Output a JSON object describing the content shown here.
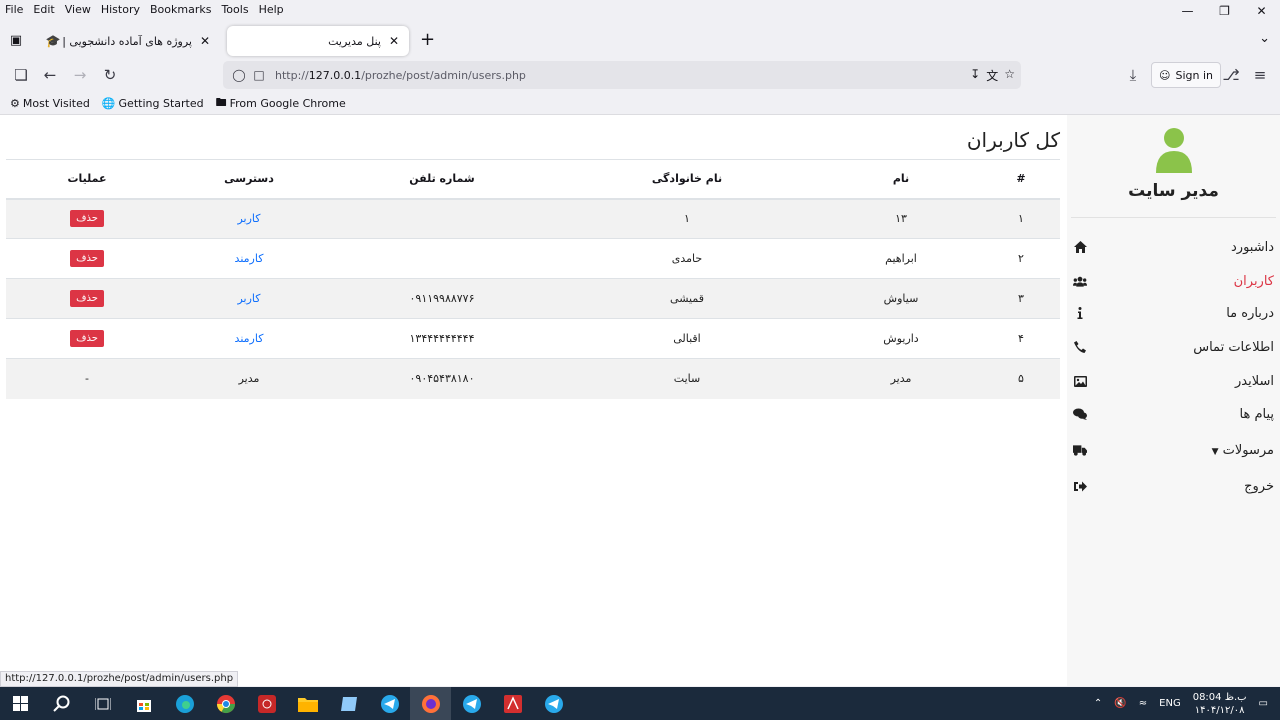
{
  "menubar": [
    "File",
    "Edit",
    "View",
    "History",
    "Bookmarks",
    "Tools",
    "Help"
  ],
  "tabs": [
    {
      "title": "پروژه های آماده دانشجویی | دانلود",
      "active": false
    },
    {
      "title": "پنل مدیریت",
      "active": true
    }
  ],
  "url": {
    "prefix": "http://",
    "host": "127.0.0.1",
    "path": "/prozhe/post/admin/users.php"
  },
  "signin": "Sign in",
  "bookmarks": [
    "Most Visited",
    "Getting Started",
    "From Google Chrome"
  ],
  "page": {
    "title": "کل کاربران",
    "table": {
      "headers": [
        "#",
        "نام",
        "نام خانوادگی",
        "شماره تلفن",
        "دسترسی",
        "عملیات"
      ],
      "rows": [
        {
          "num": "۱",
          "name": "۱۳",
          "last": "۱",
          "phone": "",
          "access": "کاربر",
          "access_link": true,
          "op": "حذف"
        },
        {
          "num": "۲",
          "name": "ابراهیم",
          "last": "حامدی",
          "phone": "",
          "access": "کارمند",
          "access_link": true,
          "op": "حذف"
        },
        {
          "num": "۳",
          "name": "سیاوش",
          "last": "قمیشی",
          "phone": "۰۹۱۱۹۹۸۸۷۷۶",
          "access": "کاربر",
          "access_link": true,
          "op": "حذف"
        },
        {
          "num": "۴",
          "name": "داریوش",
          "last": "اقبالی",
          "phone": "۱۳۴۴۴۴۴۴۴۴۴",
          "access": "کارمند",
          "access_link": true,
          "op": "حذف"
        },
        {
          "num": "۵",
          "name": "مدیر",
          "last": "سایت",
          "phone": "۰۹۰۴۵۴۳۸۱۸۰",
          "access": "مدیر",
          "access_link": false,
          "op": "-"
        }
      ]
    }
  },
  "sidebar": {
    "admin_name": "مدیر سایت",
    "items": [
      {
        "label": "داشبورد",
        "icon": "home-icon"
      },
      {
        "label": "کاربران",
        "icon": "users-icon",
        "active": true
      },
      {
        "label": "درباره ما",
        "icon": "info-icon"
      },
      {
        "label": "اطلاعات تماس",
        "icon": "phone-icon"
      },
      {
        "label": "اسلایدر",
        "icon": "image-icon"
      },
      {
        "label": "پیام ها",
        "icon": "comments-icon"
      },
      {
        "label": "مرسولات",
        "icon": "truck-icon"
      },
      {
        "label": "خروج",
        "icon": "sign-out-icon"
      }
    ]
  },
  "status_link": "http://127.0.0.1/prozhe/post/admin/users.php",
  "taskbar": {
    "lang": "ENG",
    "time": "08:04 ب.ظ",
    "date": "۱۴۰۴/۱۲/۰۸"
  },
  "colors": {
    "danger": "#dc3545",
    "link": "#0d6efd",
    "avatar": "#8bc34a"
  }
}
